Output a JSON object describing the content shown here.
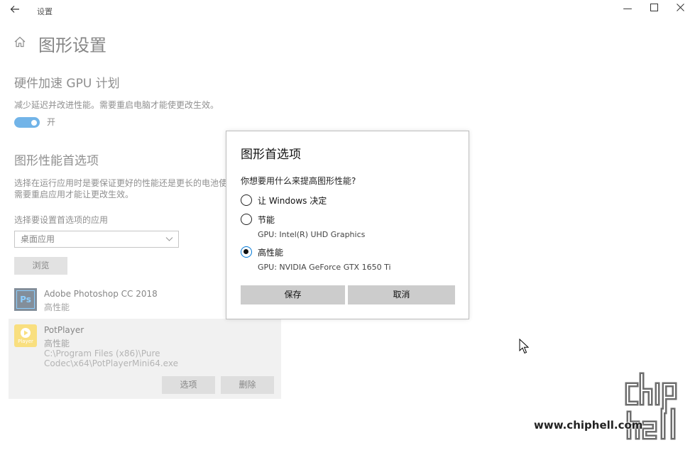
{
  "window": {
    "title": "设置",
    "back_icon": "back-arrow-icon",
    "minimize_glyph": "—",
    "maximize_glyph": "☐",
    "close_glyph": "✕"
  },
  "page": {
    "title": "图形设置",
    "home_icon": "home-icon"
  },
  "gpu_scheduling": {
    "heading": "硬件加速 GPU 计划",
    "description": "减少延迟并改进性能。需要重启电脑才能使更改生效。",
    "toggle_state_label": "开",
    "toggle_on": true
  },
  "preferences": {
    "heading": "图形性能首选项",
    "description_line1": "选择在运行应用时是要保证更好的性能还是更长的电池使用",
    "description_line2": "需要重启应用才能让更改生效。",
    "select_label": "选择要设置首选项的应用",
    "select_value": "桌面应用",
    "browse_label": "浏览"
  },
  "apps": [
    {
      "name": "Adobe Photoshop CC 2018",
      "preference": "高性能",
      "icon": "photoshop-icon",
      "icon_text": "Ps"
    },
    {
      "name": "PotPlayer",
      "preference": "高性能",
      "path": "C:\\Program Files (x86)\\Pure Codec\\x64\\PotPlayerMini64.exe",
      "icon": "potplayer-icon",
      "icon_text": "Player",
      "options_label": "选项",
      "delete_label": "删除"
    }
  ],
  "dialog": {
    "title": "图形首选项",
    "question": "你想要用什么来提高图形性能?",
    "options": [
      {
        "label": "让 Windows 决定",
        "sub": "",
        "selected": false
      },
      {
        "label": "节能",
        "sub": "GPU: Intel(R) UHD Graphics",
        "selected": false
      },
      {
        "label": "高性能",
        "sub": "GPU: NVIDIA GeForce GTX 1650 Ti",
        "selected": true
      }
    ],
    "save_label": "保存",
    "cancel_label": "取消"
  },
  "watermark": {
    "url": "www.chiphell.com",
    "logo": "chiphell-logo"
  },
  "colors": {
    "accent": "#0078d7",
    "button_gray": "#cccccc"
  }
}
